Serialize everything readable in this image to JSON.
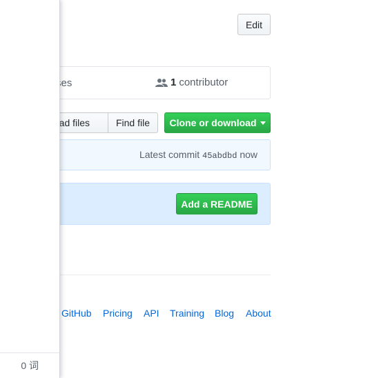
{
  "header": {
    "edit_label": "Edit"
  },
  "summary": {
    "left_fragment": "ses",
    "contributor_count": "1",
    "contributor_label": "contributor"
  },
  "file_actions": {
    "upload_label": "pload files",
    "find_label": "Find file",
    "clone_label": "Clone or download"
  },
  "commit": {
    "prefix": "Latest commit",
    "sha": "45abdbd",
    "time": "now"
  },
  "readme": {
    "button_label": "Add a README"
  },
  "footer": {
    "links": [
      "GitHub",
      "Pricing",
      "API",
      "Training",
      "Blog",
      "About"
    ]
  },
  "side_panel": {
    "word_count": "0 词"
  },
  "colors": {
    "primary_green": "#28a745",
    "link_blue": "#0366d6",
    "commit_bg": "#f1f8ff",
    "readme_bg": "#dbedff"
  }
}
